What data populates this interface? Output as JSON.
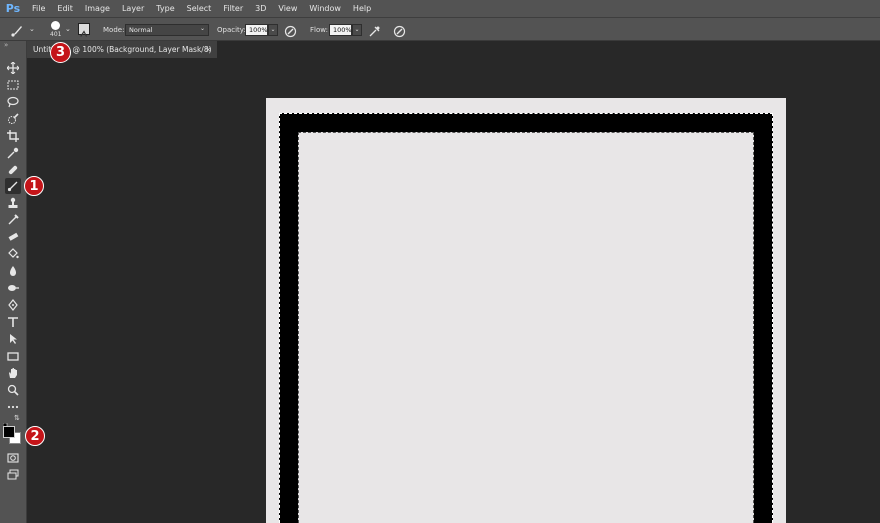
{
  "app": {
    "logo": "Ps"
  },
  "menu": [
    "File",
    "Edit",
    "Image",
    "Layer",
    "Type",
    "Select",
    "Filter",
    "3D",
    "View",
    "Window",
    "Help"
  ],
  "options": {
    "brush_size": "401",
    "mode_label": "Mode:",
    "mode_value": "Normal",
    "opacity_label": "Opacity:",
    "opacity_value": "100%",
    "flow_label": "Flow:",
    "flow_value": "100%"
  },
  "tab": {
    "title": "Untitled-1 @ 100% (Background, Layer Mask/8) *",
    "close": "×"
  },
  "badges": [
    "1",
    "2",
    "3"
  ],
  "colors": {
    "accent_badge": "#c41419",
    "foreground": "#000000",
    "background": "#ffffff"
  },
  "tools": [
    "move-icon",
    "marquee-icon",
    "lasso-icon",
    "quick-select-icon",
    "crop-icon",
    "eyedropper-icon",
    "healing-brush-icon",
    "brush-icon",
    "clone-stamp-icon",
    "history-brush-icon",
    "eraser-icon",
    "paint-bucket-icon",
    "blur-icon",
    "dodge-icon",
    "pen-icon",
    "type-icon",
    "path-select-icon",
    "rectangle-icon",
    "hand-icon",
    "zoom-icon",
    "more-tools-icon"
  ]
}
